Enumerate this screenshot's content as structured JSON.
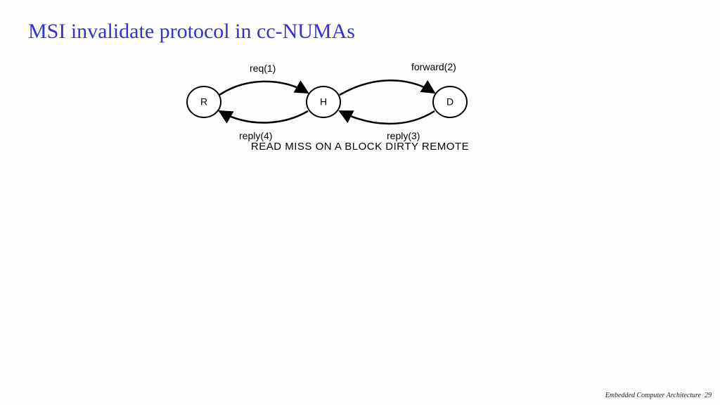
{
  "title": "MSI invalidate protocol in cc-NUMAs",
  "diagram": {
    "nodes": {
      "R": "R",
      "H": "H",
      "D": "D"
    },
    "edges": {
      "req": "req(1)",
      "forward": "forward(2)",
      "reply3": "reply(3)",
      "reply4": "reply(4)"
    },
    "caption": "READ MISS ON A BLOCK DIRTY REMOTE"
  },
  "footer": {
    "course": "Embedded Computer Architecture",
    "page": "29"
  }
}
